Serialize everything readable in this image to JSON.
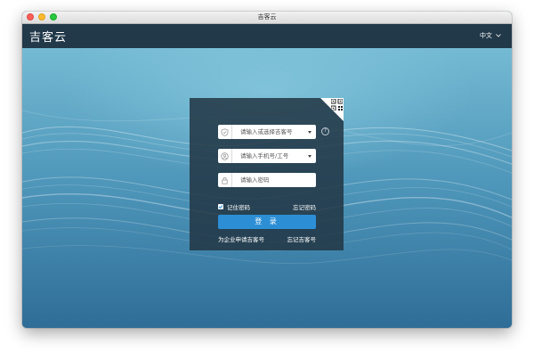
{
  "window": {
    "title": "吉客云"
  },
  "appbar": {
    "logo": "吉客云",
    "language": "中文"
  },
  "login": {
    "account_placeholder": "请输入或选择吉客号",
    "phone_placeholder": "请输入手机号/工号",
    "password_placeholder": "请输入密码",
    "help_symbol": "?",
    "remember_label": "记住密码",
    "remember_checked": true,
    "forgot_password": "忘记密码",
    "login_button": "登 录",
    "apply_link": "为企业申请吉客号",
    "forgot_account": "忘记吉客号"
  },
  "colors": {
    "appbar": "#22394a",
    "panel": "#223644",
    "button": "#2c8fd6"
  },
  "icons": {
    "account_field": "shield-icon",
    "phone_field": "user-icon",
    "password_field": "lock-icon",
    "corner": "qr-code-icon",
    "language": "chevron-down-icon"
  }
}
